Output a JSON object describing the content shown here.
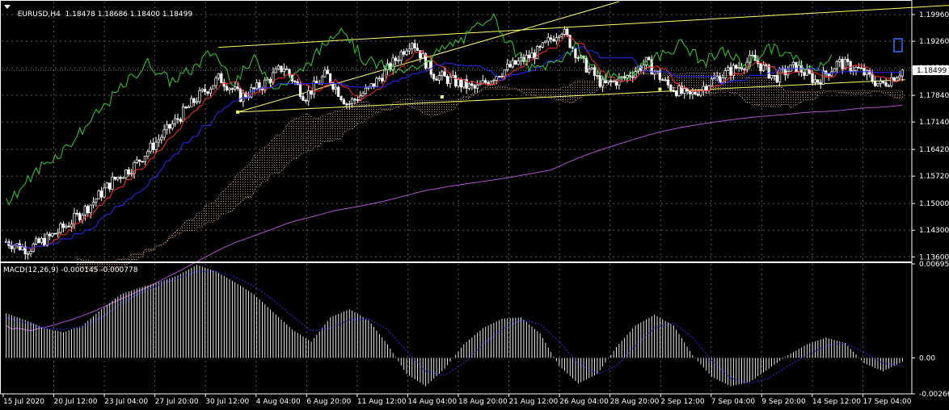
{
  "symbol_line": {
    "symbol": "EURUSD,H4",
    "open": "1.18478",
    "high": "1.18686",
    "low": "1.18400",
    "close": "1.18499"
  },
  "macd_label": "MACD(12,26,9) -0.000145 -0.000778",
  "colors": {
    "background": "#000000",
    "grid": "#5a5a5a",
    "candle": "#ffffff",
    "tenkan": "#ff2a2a",
    "kijun": "#2a2aff",
    "chikou": "#33cc33",
    "senkou_cloud": "#f4b58a",
    "ma": "#b050d0",
    "trendline": "#ffff66",
    "price_tag": "#ffffff",
    "macd_hist": "#ffffff",
    "macd_signal": "#2a2aff"
  },
  "chart_data": [
    {
      "type": "candlestick",
      "title": "EURUSD,H4",
      "y_ticks": [
        "1.19960",
        "1.19260",
        "1.18560",
        "1.17840",
        "1.17140",
        "1.16420",
        "1.15720",
        "1.15000",
        "1.14300",
        "1.13600"
      ],
      "ylim": [
        1.135,
        1.203
      ],
      "current_price": "1.18499",
      "x_ticks": [
        "15 Jul 2020",
        "20 Jul 12:00",
        "23 Jul 04:00",
        "27 Jul 20:00",
        "30 Jul 12:00",
        "4 Aug 04:00",
        "6 Aug 20:00",
        "11 Aug 12:00",
        "14 Aug 04:00",
        "18 Aug 20:00",
        "21 Aug 12:00",
        "26 Aug 04:00",
        "28 Aug 20:00",
        "2 Sep 12:00",
        "7 Sep 04:00",
        "9 Sep 20:00",
        "14 Sep 12:00",
        "17 Sep 04:00"
      ],
      "close_path": [
        1.14,
        1.138,
        1.141,
        1.145,
        1.15,
        1.156,
        1.16,
        1.166,
        1.172,
        1.178,
        1.183,
        1.178,
        1.181,
        1.186,
        1.178,
        1.184,
        1.176,
        1.18,
        1.186,
        1.193,
        1.184,
        1.182,
        1.18,
        1.184,
        1.187,
        1.19,
        1.196,
        1.187,
        1.181,
        1.183,
        1.187,
        1.181,
        1.178,
        1.182,
        1.185,
        1.188,
        1.183,
        1.186,
        1.182,
        1.187,
        1.185,
        1.181,
        1.185
      ],
      "indicators": [
        "Ichimoku tenkan (red)",
        "Ichimoku kijun (blue)",
        "Chikou span (green)",
        "Kumo cloud (orange dotted)",
        "Moving average (purple)"
      ],
      "trendlines": "yellow channel and fan lines"
    },
    {
      "type": "bar",
      "title": "MACD(12,26,9)",
      "y_ticks": [
        "0.006959",
        "0.00",
        "-0.002669"
      ],
      "ylim": [
        -0.002669,
        0.006959
      ],
      "hist_path": [
        0.0033,
        0.0028,
        0.0022,
        0.0019,
        0.0024,
        0.0036,
        0.0047,
        0.0052,
        0.0056,
        0.0061,
        0.0069,
        0.0064,
        0.0056,
        0.0047,
        0.0034,
        0.0021,
        0.0012,
        0.003,
        0.0036,
        0.0028,
        0.001,
        -0.0012,
        -0.0021,
        -0.0008,
        0.001,
        0.0022,
        0.0029,
        0.003,
        0.0018,
        -0.0006,
        -0.0019,
        -0.0012,
        0.0008,
        0.0024,
        0.0032,
        0.0024,
        0.0002,
        -0.0014,
        -0.0021,
        -0.0018,
        -0.0008,
        0.0002,
        0.001,
        0.0015,
        0.0011,
        -0.0004,
        -0.001,
        -0.0003
      ],
      "signal_path": [
        0.003,
        0.0026,
        0.0022,
        0.0021,
        0.0023,
        0.003,
        0.004,
        0.0048,
        0.0054,
        0.0059,
        0.0064,
        0.0064,
        0.006,
        0.0053,
        0.0043,
        0.0031,
        0.002,
        0.0022,
        0.0028,
        0.0029,
        0.0021,
        0.0005,
        -0.001,
        -0.0013,
        -0.0004,
        0.001,
        0.0021,
        0.0028,
        0.0025,
        0.0012,
        -0.0004,
        -0.0012,
        -0.0006,
        0.0009,
        0.0022,
        0.0026,
        0.0015,
        -0.0002,
        -0.0015,
        -0.0019,
        -0.0015,
        -0.0006,
        0.0002,
        0.0009,
        0.0011,
        0.0004,
        -0.0004,
        -0.0006
      ]
    }
  ]
}
